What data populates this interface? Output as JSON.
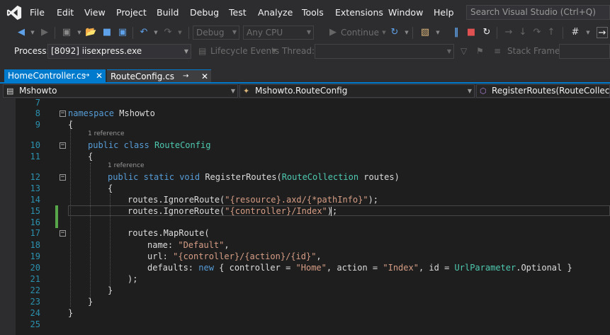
{
  "menu": {
    "items": [
      "File",
      "Edit",
      "View",
      "Project",
      "Build",
      "Debug",
      "Test",
      "Analyze",
      "Tools",
      "Extensions",
      "Window",
      "Help"
    ],
    "search_placeholder": "Search Visual Studio (Ctrl+Q)"
  },
  "toolbar": {
    "config": "Debug",
    "platform": "Any CPU",
    "continue_label": "Continue"
  },
  "debugbar": {
    "process_label": "Process:",
    "process_value": "[8092] iisexpress.exe",
    "lifecycle_label": "Lifecycle Events",
    "thread_label": "Thread:",
    "stackframe_label": "Stack Frame:"
  },
  "tabs": [
    {
      "label": "HomeController.cs",
      "active": false
    },
    {
      "label": "RouteConfig.cs",
      "active": true
    }
  ],
  "navbar": {
    "project": "Mshowto",
    "type": "Mshowto.RouteConfig",
    "member": "RegisterRoutes(RouteCollection"
  },
  "editor": {
    "reference_label": "1 reference",
    "line_numbers": [
      "7",
      "8",
      "9",
      "10",
      "11",
      "12",
      "13",
      "14",
      "15",
      "16",
      "17",
      "18",
      "19",
      "20",
      "21",
      "22",
      "23",
      "24",
      "25"
    ],
    "lines": {
      "l8": [
        "namespace",
        " Mshowto"
      ],
      "l9": "{",
      "l10": [
        "public",
        " ",
        "class",
        " ",
        "RouteConfig"
      ],
      "l11": "{",
      "l12": [
        "public",
        " ",
        "static",
        " ",
        "void",
        " RegisterRoutes(",
        "RouteCollection",
        " routes)"
      ],
      "l13": "{",
      "l14": [
        "routes.IgnoreRoute(",
        "\"{resource}.axd/{*pathInfo}\"",
        ");"
      ],
      "l15": [
        "routes.IgnoreRoute(",
        "\"{controller}/Index\"",
        ");"
      ],
      "l17": "routes.MapRoute(",
      "l18": [
        "name: ",
        "\"Default\"",
        ","
      ],
      "l19": [
        "url: ",
        "\"{controller}/{action}/{id}\"",
        ","
      ],
      "l20": [
        "defaults: ",
        "new",
        " { controller = ",
        "\"Home\"",
        ", action = ",
        "\"Index\"",
        ", id = ",
        "UrlParameter",
        ".Optional }"
      ],
      "l21": ");",
      "l22": "}",
      "l23": "}",
      "l24": "}"
    }
  },
  "colors": {
    "accent": "#007acc",
    "keyword": "#569cd6",
    "type": "#4ec9b0",
    "string": "#d69d85",
    "line_number": "#2b91af",
    "changed_marker": "#57a64a"
  }
}
